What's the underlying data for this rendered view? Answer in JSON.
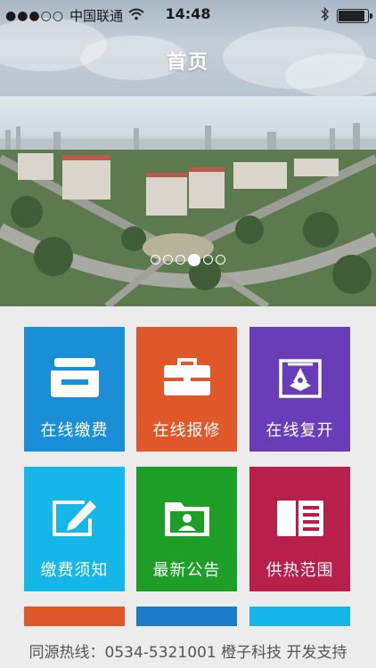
{
  "status_bar": {
    "signal_dots": "●●●○○",
    "carrier": "中国联通",
    "time": "14:48"
  },
  "nav": {
    "title": "首页"
  },
  "banner": {
    "pages": 6,
    "active_page": 4
  },
  "tiles": [
    {
      "label": "在线缴费",
      "icon": "tray-icon",
      "color": "#1a8fd8"
    },
    {
      "label": "在线报修",
      "icon": "toolbox-icon",
      "color": "#e0582a"
    },
    {
      "label": "在线复开",
      "icon": "valve-icon",
      "color": "#6a3db8"
    },
    {
      "label": "缴费须知",
      "icon": "edit-icon",
      "color": "#15b6e8"
    },
    {
      "label": "最新公告",
      "icon": "contact-folder-icon",
      "color": "#1d9e27"
    },
    {
      "label": "供热范围",
      "icon": "document-icon",
      "color": "#b81f4a"
    }
  ],
  "strip_colors": [
    "#e0582a",
    "#1a7cc9",
    "#15b6e8"
  ],
  "footer": {
    "text": "同源热线：0534-5321001 橙子科技 开发支持"
  }
}
